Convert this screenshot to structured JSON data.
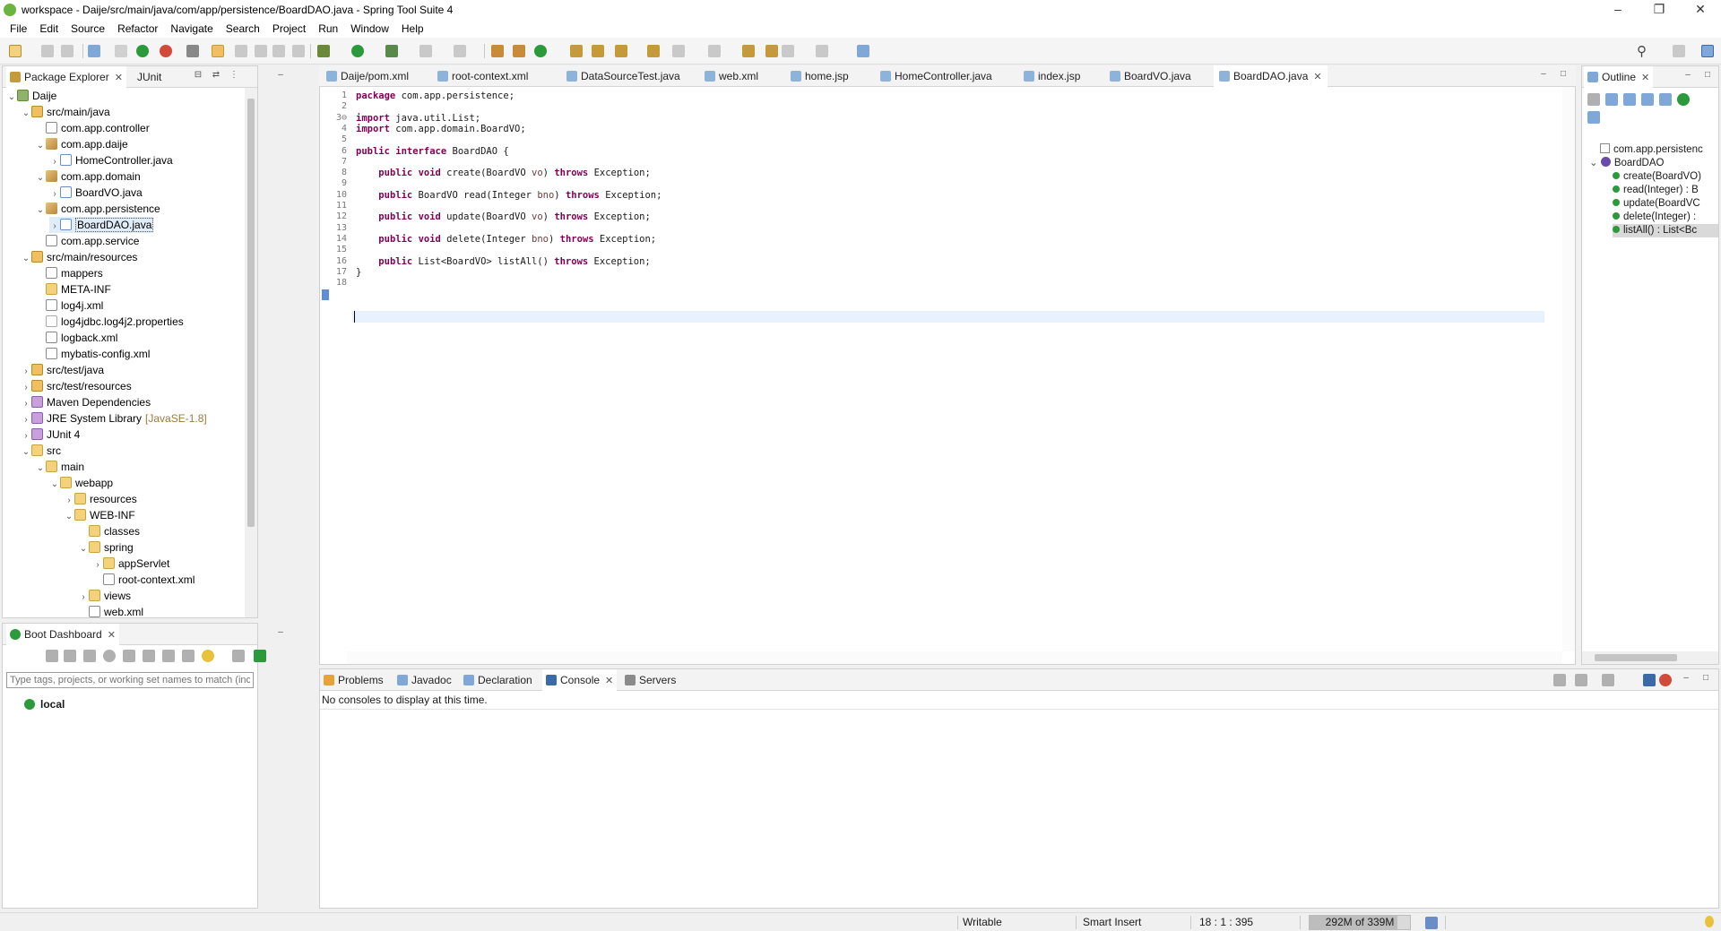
{
  "window": {
    "title": "workspace - Daije/src/main/java/com/app/persistence/BoardDAO.java - Spring Tool Suite 4",
    "controls": [
      "–",
      "❐",
      "✕"
    ]
  },
  "menu": [
    "File",
    "Edit",
    "Source",
    "Refactor",
    "Navigate",
    "Search",
    "Project",
    "Run",
    "Window",
    "Help"
  ],
  "package_explorer": {
    "tabs": [
      "Package Explorer",
      "JUnit"
    ],
    "tree": [
      {
        "label": "Daije",
        "indent": 0,
        "twisty": "v",
        "icon": "project"
      },
      {
        "label": "src/main/java",
        "indent": 1,
        "twisty": "v",
        "icon": "srcfolder"
      },
      {
        "label": "com.app.controller",
        "indent": 2,
        "twisty": "",
        "icon": "pkg-empty"
      },
      {
        "label": "com.app.daije",
        "indent": 2,
        "twisty": "v",
        "icon": "pkg"
      },
      {
        "label": "HomeController.java",
        "indent": 3,
        "twisty": ">",
        "icon": "java"
      },
      {
        "label": "com.app.domain",
        "indent": 2,
        "twisty": "v",
        "icon": "pkg"
      },
      {
        "label": "BoardVO.java",
        "indent": 3,
        "twisty": ">",
        "icon": "java"
      },
      {
        "label": "com.app.persistence",
        "indent": 2,
        "twisty": "v",
        "icon": "pkg"
      },
      {
        "label": "BoardDAO.java",
        "indent": 3,
        "twisty": ">",
        "icon": "java",
        "selected": true
      },
      {
        "label": "com.app.service",
        "indent": 2,
        "twisty": "",
        "icon": "pkg-empty"
      },
      {
        "label": "src/main/resources",
        "indent": 1,
        "twisty": "v",
        "icon": "srcfolder"
      },
      {
        "label": "mappers",
        "indent": 2,
        "twisty": "",
        "icon": "pkg-empty"
      },
      {
        "label": "META-INF",
        "indent": 2,
        "twisty": "",
        "icon": "folder"
      },
      {
        "label": "log4j.xml",
        "indent": 2,
        "twisty": "",
        "icon": "xml"
      },
      {
        "label": "log4jdbc.log4j2.properties",
        "indent": 2,
        "twisty": "",
        "icon": "props"
      },
      {
        "label": "logback.xml",
        "indent": 2,
        "twisty": "",
        "icon": "xml"
      },
      {
        "label": "mybatis-config.xml",
        "indent": 2,
        "twisty": "",
        "icon": "xml"
      },
      {
        "label": "src/test/java",
        "indent": 1,
        "twisty": ">",
        "icon": "srcfolder"
      },
      {
        "label": "src/test/resources",
        "indent": 1,
        "twisty": ">",
        "icon": "srcfolder"
      },
      {
        "label": "Maven Dependencies",
        "indent": 1,
        "twisty": ">",
        "icon": "lib"
      },
      {
        "label": "JRE System Library",
        "indent": 1,
        "twisty": ">",
        "icon": "lib",
        "suffix": "[JavaSE-1.8]"
      },
      {
        "label": "JUnit 4",
        "indent": 1,
        "twisty": ">",
        "icon": "lib"
      },
      {
        "label": "src",
        "indent": 1,
        "twisty": "v",
        "icon": "folder"
      },
      {
        "label": "main",
        "indent": 2,
        "twisty": "v",
        "icon": "folder"
      },
      {
        "label": "webapp",
        "indent": 3,
        "twisty": "v",
        "icon": "folder"
      },
      {
        "label": "resources",
        "indent": 4,
        "twisty": ">",
        "icon": "folder"
      },
      {
        "label": "WEB-INF",
        "indent": 4,
        "twisty": "v",
        "icon": "folder"
      },
      {
        "label": "classes",
        "indent": 5,
        "twisty": "",
        "icon": "folder"
      },
      {
        "label": "spring",
        "indent": 5,
        "twisty": "v",
        "icon": "folder"
      },
      {
        "label": "appServlet",
        "indent": 6,
        "twisty": ">",
        "icon": "folder"
      },
      {
        "label": "root-context.xml",
        "indent": 6,
        "twisty": "",
        "icon": "xml"
      },
      {
        "label": "views",
        "indent": 5,
        "twisty": ">",
        "icon": "folder"
      },
      {
        "label": "web.xml",
        "indent": 5,
        "twisty": "",
        "icon": "xml"
      }
    ]
  },
  "boot_dashboard": {
    "title": "Boot Dashboard",
    "filter_placeholder": "Type tags, projects, or working set names to match (incl. * and",
    "items": [
      "local"
    ]
  },
  "editor": {
    "tabs": [
      "Daije/pom.xml",
      "root-context.xml",
      "DataSourceTest.java",
      "web.xml",
      "home.jsp",
      "HomeController.java",
      "index.jsp",
      "BoardVO.java",
      "BoardDAO.java"
    ],
    "active_tab": "BoardDAO.java",
    "lines": [
      {
        "n": "1",
        "tokens": [
          [
            "kw",
            "package"
          ],
          [
            "t",
            " com.app.persistence;"
          ]
        ]
      },
      {
        "n": "2",
        "tokens": []
      },
      {
        "n": "3⊖",
        "tokens": [
          [
            "kw",
            "import"
          ],
          [
            "t",
            " java.util.List;"
          ]
        ]
      },
      {
        "n": "4",
        "tokens": [
          [
            "kw",
            "import"
          ],
          [
            "t",
            " com.app.domain.BoardVO;"
          ]
        ]
      },
      {
        "n": "5",
        "tokens": []
      },
      {
        "n": "6",
        "tokens": [
          [
            "kw",
            "public"
          ],
          [
            "t",
            " "
          ],
          [
            "kw",
            "interface"
          ],
          [
            "t",
            " BoardDAO {"
          ]
        ]
      },
      {
        "n": "7",
        "tokens": []
      },
      {
        "n": "8",
        "tokens": [
          [
            "t",
            "    "
          ],
          [
            "kw",
            "public"
          ],
          [
            "t",
            " "
          ],
          [
            "kw",
            "void"
          ],
          [
            "t",
            " create(BoardVO "
          ],
          [
            "p",
            "vo"
          ],
          [
            "t",
            ") "
          ],
          [
            "kw",
            "throws"
          ],
          [
            "t",
            " Exception;"
          ]
        ]
      },
      {
        "n": "9",
        "tokens": []
      },
      {
        "n": "10",
        "tokens": [
          [
            "t",
            "    "
          ],
          [
            "kw",
            "public"
          ],
          [
            "t",
            " BoardVO read(Integer "
          ],
          [
            "p",
            "bno"
          ],
          [
            "t",
            ") "
          ],
          [
            "kw",
            "throws"
          ],
          [
            "t",
            " Exception;"
          ]
        ]
      },
      {
        "n": "11",
        "tokens": []
      },
      {
        "n": "12",
        "tokens": [
          [
            "t",
            "    "
          ],
          [
            "kw",
            "public"
          ],
          [
            "t",
            " "
          ],
          [
            "kw",
            "void"
          ],
          [
            "t",
            " update(BoardVO "
          ],
          [
            "p",
            "vo"
          ],
          [
            "t",
            ") "
          ],
          [
            "kw",
            "throws"
          ],
          [
            "t",
            " Exception;"
          ]
        ]
      },
      {
        "n": "13",
        "tokens": []
      },
      {
        "n": "14",
        "tokens": [
          [
            "t",
            "    "
          ],
          [
            "kw",
            "public"
          ],
          [
            "t",
            " "
          ],
          [
            "kw",
            "void"
          ],
          [
            "t",
            " delete(Integer "
          ],
          [
            "p",
            "bno"
          ],
          [
            "t",
            ") "
          ],
          [
            "kw",
            "throws"
          ],
          [
            "t",
            " Exception;"
          ]
        ]
      },
      {
        "n": "15",
        "tokens": []
      },
      {
        "n": "16",
        "tokens": [
          [
            "t",
            "    "
          ],
          [
            "kw",
            "public"
          ],
          [
            "t",
            " List<BoardVO> listAll() "
          ],
          [
            "kw",
            "throws"
          ],
          [
            "t",
            " Exception;"
          ]
        ]
      },
      {
        "n": "17",
        "tokens": [
          [
            "t",
            "}"
          ]
        ]
      },
      {
        "n": "18",
        "tokens": []
      }
    ]
  },
  "outline": {
    "title": "Outline",
    "items": [
      {
        "label": "com.app.persistenc",
        "indent": 0,
        "icon": "pkg"
      },
      {
        "label": "BoardDAO",
        "indent": 0,
        "icon": "interface",
        "twisty": "v"
      },
      {
        "label": "create(BoardVO)",
        "indent": 1,
        "icon": "method"
      },
      {
        "label": "read(Integer) : B",
        "indent": 1,
        "icon": "method"
      },
      {
        "label": "update(BoardVC",
        "indent": 1,
        "icon": "method"
      },
      {
        "label": "delete(Integer) :",
        "indent": 1,
        "icon": "method"
      },
      {
        "label": "listAll() : List<Bc",
        "indent": 1,
        "icon": "method",
        "selected": true
      }
    ]
  },
  "bottom_panel": {
    "tabs": [
      "Problems",
      "Javadoc",
      "Declaration",
      "Console",
      "Servers"
    ],
    "active_tab": "Console",
    "message": "No consoles to display at this time."
  },
  "status": {
    "writable": "Writable",
    "insert_mode": "Smart Insert",
    "position": "18 : 1 : 395",
    "memory": "292M of 339M"
  }
}
